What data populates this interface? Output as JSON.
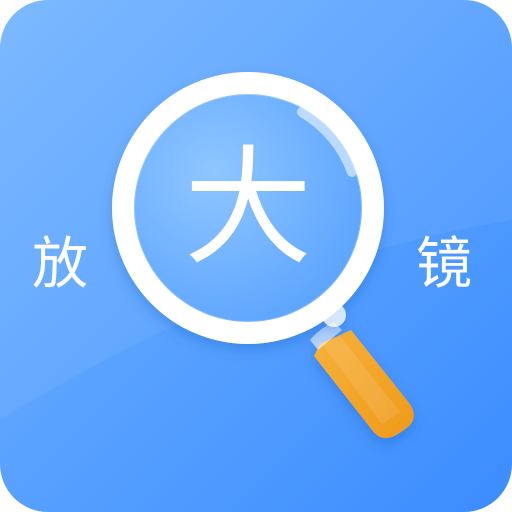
{
  "icon": {
    "center_char": "大",
    "left_char": "放",
    "right_char": "镜",
    "colors": {
      "background_light": "#6fb0ff",
      "background_dark": "#3b8cff",
      "lens_ring": "#ffffff",
      "lens_fill": "#79b7ff",
      "handle": "#f3a225",
      "handle_shadow": "#e08d12",
      "text": "#ffffff"
    },
    "icon_names": {
      "lens": "magnifier-lens-icon",
      "handle": "magnifier-handle-icon"
    }
  }
}
